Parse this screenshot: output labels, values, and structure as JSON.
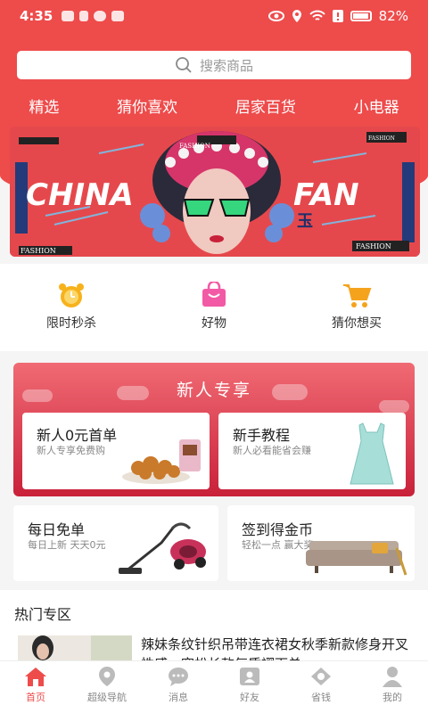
{
  "status": {
    "time": "4:35",
    "battery": "82%",
    "left_icons": [
      "notification-icon",
      "app-icon",
      "cloud-icon",
      "message-icon"
    ],
    "right_icons": [
      "eye-icon",
      "location-icon",
      "wifi-icon",
      "alert-icon",
      "battery-icon"
    ]
  },
  "search": {
    "placeholder": "搜索商品"
  },
  "categories": [
    "精选",
    "猜你喜欢",
    "居家百货",
    "小电器"
  ],
  "banner": {
    "left_text": "CHINA",
    "right_text": "FAN",
    "tag_fashion": "FASHION",
    "tag_bottom_left": "FASHION",
    "tag_bottom_right": "FASHION",
    "tag_top": "FASHION",
    "glyph": "玉"
  },
  "quick": [
    {
      "label": "限时秒杀",
      "icon": "alarm-clock-icon"
    },
    {
      "label": "好物",
      "icon": "shopping-bag-icon"
    },
    {
      "label": "猜你想买",
      "icon": "cart-icon"
    }
  ],
  "newbie": {
    "title": "新人专享",
    "cards": [
      {
        "title": "新人0元首单",
        "subtitle": "新人专享免费购"
      },
      {
        "title": "新手教程",
        "subtitle": "新人必看能省会赚"
      }
    ]
  },
  "mid": [
    {
      "title": "每日免单",
      "subtitle": "每日上新  天天0元"
    },
    {
      "title": "签到得金币",
      "subtitle": "轻松一点  赢大奖"
    }
  ],
  "hot": {
    "title": "热门专区",
    "item_text": "辣妹条纹针织吊带连衣裙女秋季新款修身开叉性感…宽松长款气质褶下单"
  },
  "tabs": [
    {
      "label": "首页",
      "icon": "home-icon",
      "active": true
    },
    {
      "label": "超级导航",
      "icon": "navigation-pin-icon",
      "active": false
    },
    {
      "label": "消息",
      "icon": "chat-bubble-icon",
      "active": false
    },
    {
      "label": "好友",
      "icon": "contact-card-icon",
      "active": false
    },
    {
      "label": "省钱",
      "icon": "coupon-icon",
      "active": false
    },
    {
      "label": "我的",
      "icon": "user-icon",
      "active": false
    }
  ],
  "colors": {
    "accent": "#ee4b4b",
    "newbie_top": "#f06a73",
    "newbie_bottom": "#c9213a"
  }
}
